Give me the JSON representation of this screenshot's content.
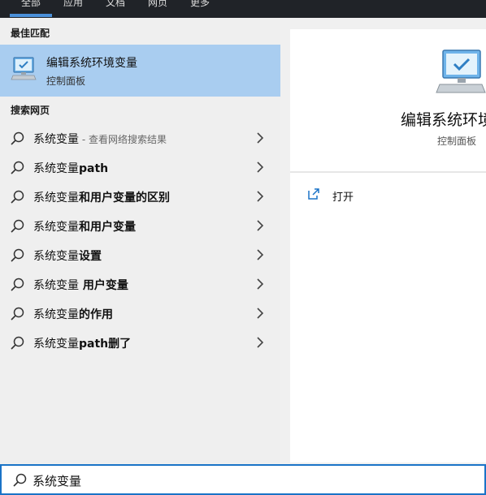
{
  "top_tabs": [
    "全部",
    "应用",
    "文档",
    "网页",
    "更多"
  ],
  "best_match": {
    "header": "最佳匹配",
    "title": "编辑系统环境变量",
    "subtitle": "控制面板"
  },
  "web": {
    "header": "搜索网页",
    "results": [
      {
        "prefix": "系统变量",
        "bold": "",
        "hint": " - 查看网络搜索结果"
      },
      {
        "prefix": "系统变量",
        "bold": "path",
        "hint": ""
      },
      {
        "prefix": "系统变量",
        "bold": "和用户变量的区别",
        "hint": ""
      },
      {
        "prefix": "系统变量",
        "bold": "和用户变量",
        "hint": ""
      },
      {
        "prefix": "系统变量",
        "bold": "设置",
        "hint": ""
      },
      {
        "prefix": "系统变量",
        "bold": " 用户变量",
        "hint": ""
      },
      {
        "prefix": "系统变量",
        "bold": "的作用",
        "hint": ""
      },
      {
        "prefix": "系统变量",
        "bold": "path删了",
        "hint": ""
      }
    ]
  },
  "preview": {
    "title": "编辑系统环境",
    "subtitle": "控制面板",
    "open_label": "打开"
  },
  "search": {
    "value": "系统变量"
  },
  "colors": {
    "selected_bg": "#a9cdf0",
    "accent": "#1a73c7"
  }
}
